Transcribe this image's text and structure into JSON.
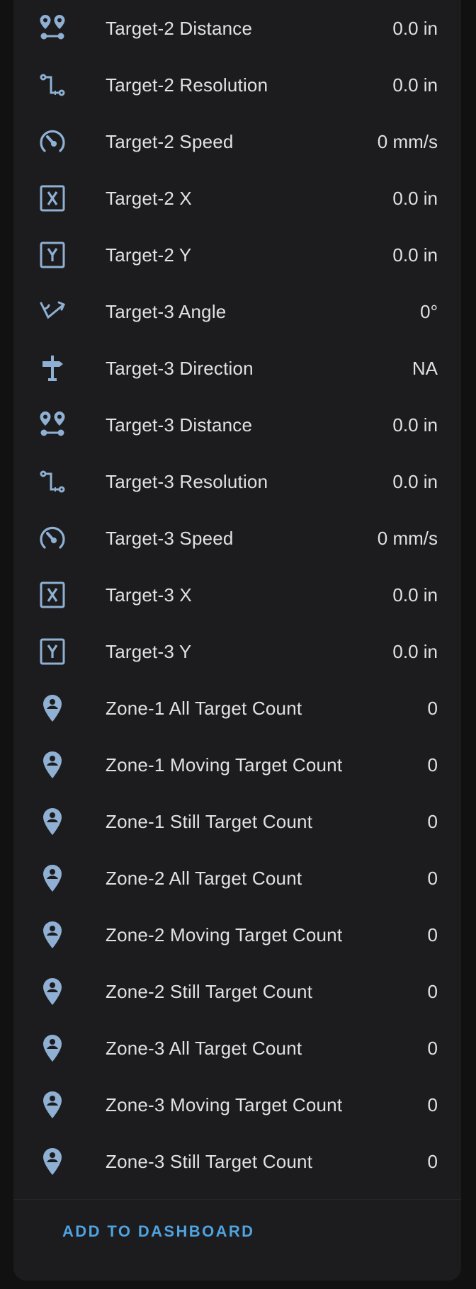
{
  "colors": {
    "icon": "#8fb0d3",
    "text": "#e1e1e1",
    "accent": "#4fa3e0",
    "card": "#1c1c1e",
    "background": "#111111"
  },
  "rows": [
    {
      "icon": "map-marker-distance-icon",
      "label": "Target-2 Distance",
      "value": "0.0 in"
    },
    {
      "icon": "ruler-resolution-icon",
      "label": "Target-2 Resolution",
      "value": "0.0 in"
    },
    {
      "icon": "speedometer-icon",
      "label": "Target-2 Speed",
      "value": "0 mm/s"
    },
    {
      "icon": "alpha-x-box-icon",
      "label": "Target-2 X",
      "value": "0.0 in"
    },
    {
      "icon": "alpha-y-box-icon",
      "label": "Target-2 Y",
      "value": "0.0 in"
    },
    {
      "icon": "angle-acute-icon",
      "label": "Target-3 Angle",
      "value": "0°"
    },
    {
      "icon": "sign-direction-icon",
      "label": "Target-3 Direction",
      "value": "NA"
    },
    {
      "icon": "map-marker-distance-icon",
      "label": "Target-3 Distance",
      "value": "0.0 in"
    },
    {
      "icon": "ruler-resolution-icon",
      "label": "Target-3 Resolution",
      "value": "0.0 in"
    },
    {
      "icon": "speedometer-icon",
      "label": "Target-3 Speed",
      "value": "0 mm/s"
    },
    {
      "icon": "alpha-x-box-icon",
      "label": "Target-3 X",
      "value": "0.0 in"
    },
    {
      "icon": "alpha-y-box-icon",
      "label": "Target-3 Y",
      "value": "0.0 in"
    },
    {
      "icon": "map-marker-account-icon",
      "label": "Zone-1 All Target Count",
      "value": "0"
    },
    {
      "icon": "map-marker-account-icon",
      "label": "Zone-1 Moving Target Count",
      "value": "0"
    },
    {
      "icon": "map-marker-account-icon",
      "label": "Zone-1 Still Target Count",
      "value": "0"
    },
    {
      "icon": "map-marker-account-icon",
      "label": "Zone-2 All Target Count",
      "value": "0"
    },
    {
      "icon": "map-marker-account-icon",
      "label": "Zone-2 Moving Target Count",
      "value": "0"
    },
    {
      "icon": "map-marker-account-icon",
      "label": "Zone-2 Still Target Count",
      "value": "0"
    },
    {
      "icon": "map-marker-account-icon",
      "label": "Zone-3 All Target Count",
      "value": "0"
    },
    {
      "icon": "map-marker-account-icon",
      "label": "Zone-3 Moving Target Count",
      "value": "0"
    },
    {
      "icon": "map-marker-account-icon",
      "label": "Zone-3 Still Target Count",
      "value": "0"
    }
  ],
  "footer": {
    "add_label": "ADD TO DASHBOARD"
  }
}
